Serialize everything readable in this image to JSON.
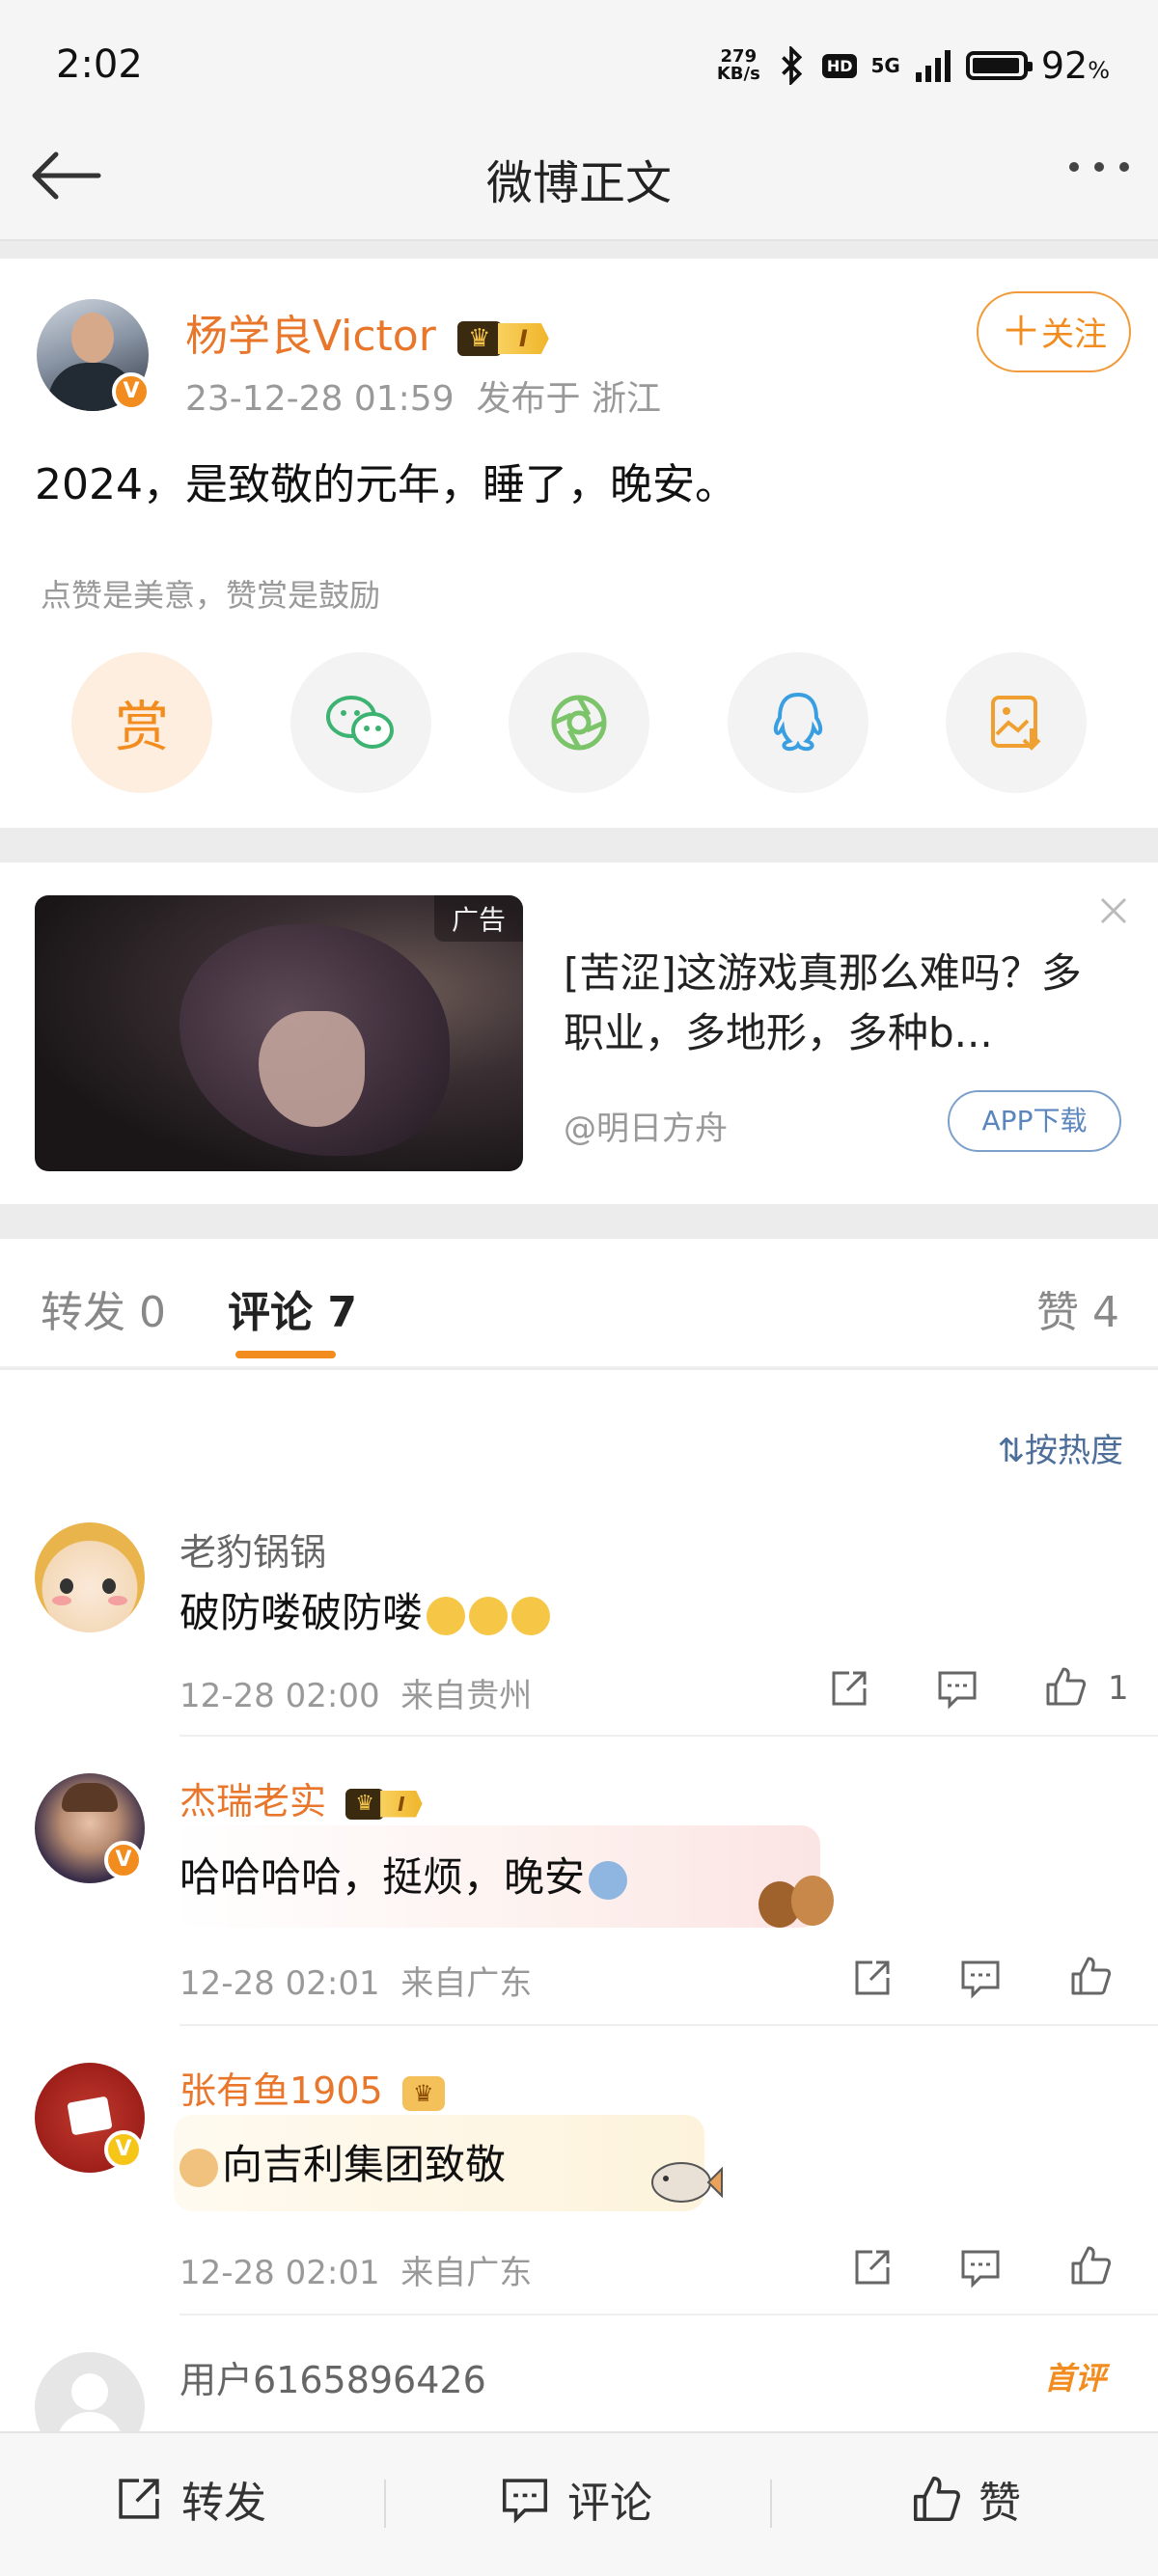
{
  "status": {
    "time": "2:02",
    "net_speed_value": "279",
    "net_speed_unit": "KB/s",
    "hd": "HD",
    "network": "5G",
    "battery_value": "92",
    "battery_unit": "%"
  },
  "header": {
    "title": "微博正文"
  },
  "post": {
    "username": "杨学良Victor",
    "level_badge": "I",
    "timestamp": "23-12-28 01:59",
    "location": "发布于 浙江",
    "follow_label": "关注",
    "text": "2024，是致敬的元年，睡了，晚安。",
    "reward_hint": "点赞是美意，赞赏是鼓励",
    "reward_label": "赏"
  },
  "ad": {
    "badge": "广告",
    "title": "[苦涩]这游戏真那么难吗？多职业，多地形，多种b...",
    "source": "@明日方舟",
    "button": "APP下载"
  },
  "tabs": {
    "repost": "转发 0",
    "comment": "评论 7",
    "like": "赞 4"
  },
  "sort_label": "按热度",
  "comments": [
    {
      "name": "老豹锅锅",
      "text": "破防喽破防喽",
      "time": "12-28 02:00",
      "location": "来自贵州",
      "likes": "1"
    },
    {
      "name": "杰瑞老实",
      "level_badge": "I",
      "text": "哈哈哈哈，挺烦，晚安",
      "time": "12-28 02:01",
      "location": "来自广东"
    },
    {
      "name": "张有鱼1905",
      "text": "向吉利集团致敬",
      "time": "12-28 02:01",
      "location": "来自广东"
    },
    {
      "name": "用户6165896426",
      "tag": "首评"
    }
  ],
  "bottom": {
    "repost": "转发",
    "comment": "评论",
    "like": "赞"
  },
  "colors": {
    "accent": "#f28c1e",
    "link_blue": "#4d6e99",
    "name_orange": "#e8762b"
  }
}
